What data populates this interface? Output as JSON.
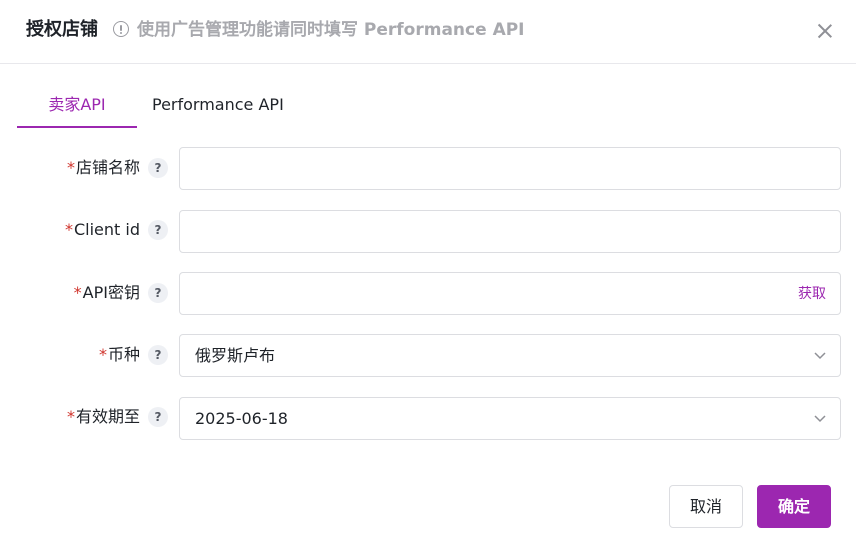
{
  "dialog": {
    "title": "授权店铺",
    "notice": "使用广告管理功能请同时填写 Performance API",
    "accent_color": "#9c27b0",
    "required_color": "#d0342c"
  },
  "tabs": [
    {
      "label": "卖家API",
      "active": true
    },
    {
      "label": "Performance API",
      "active": false
    }
  ],
  "form": {
    "required_mark": "*",
    "help_mark": "?",
    "shop_name": {
      "label": "店铺名称",
      "value": "",
      "placeholder": ""
    },
    "client_id": {
      "label": "Client id",
      "value": "",
      "placeholder": ""
    },
    "api_key": {
      "label": "API密钥",
      "value": "",
      "placeholder": "",
      "action_label": "获取"
    },
    "currency": {
      "label": "币种",
      "value": "俄罗斯卢布"
    },
    "valid_until": {
      "label": "有效期至",
      "value": "2025-06-18"
    }
  },
  "footer": {
    "cancel_label": "取消",
    "confirm_label": "确定"
  }
}
